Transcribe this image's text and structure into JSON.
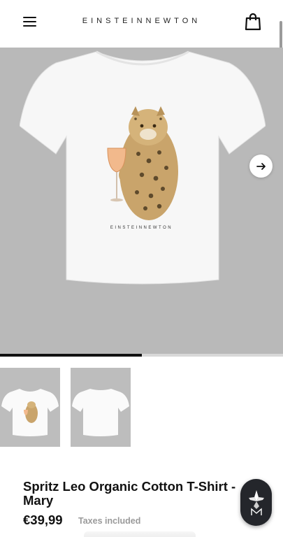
{
  "header": {
    "brand": "EINSTEINNEWTON",
    "menu_icon": "hamburger-menu-icon",
    "bag_icon": "shopping-bag-icon"
  },
  "gallery": {
    "print_brand": "EINSTEINNEWTON",
    "next_icon": "arrow-right-icon",
    "progress": 0.5,
    "thumbnails": [
      "front-view",
      "back-view"
    ]
  },
  "product": {
    "title": "Spritz Leo Organic Cotton T-Shirt - Mary",
    "price": "€39,99",
    "taxes_note": "Taxes included"
  },
  "colors": {
    "gallery_bg": "#b9b9b9",
    "badge_bg": "#24262b"
  }
}
